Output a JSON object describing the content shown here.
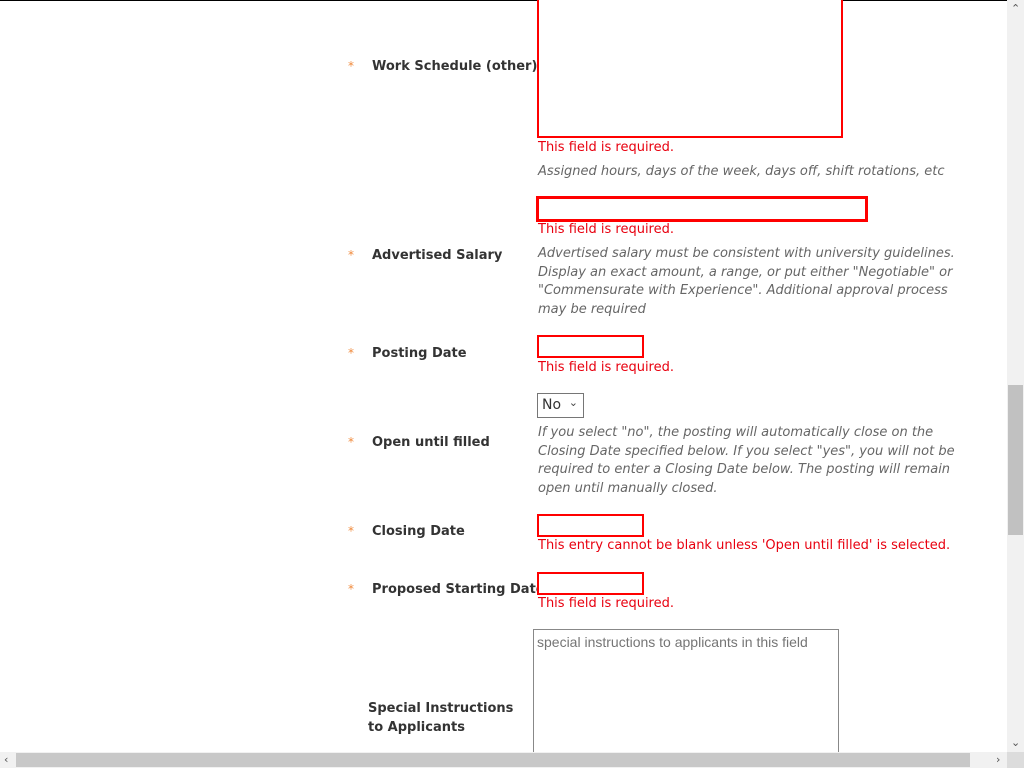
{
  "required_marker": "*",
  "fields": {
    "work_schedule": {
      "label": "Work Schedule (other)",
      "error": "This field is required.",
      "hint": "Assigned hours, days of the week, days off, shift rotations, etc"
    },
    "advertised_salary": {
      "label": "Advertised Salary",
      "error": "This field is required.",
      "hint": "Advertised salary must be consistent with university guidelines. Display an exact amount, a range, or put either \"Negotiable\" or \"Commensurate with Experience\". Additional approval process may be required"
    },
    "posting_date": {
      "label": "Posting Date",
      "error": "This field is required."
    },
    "open_until_filled": {
      "label": "Open until filled",
      "selected": "No",
      "hint": "If you select \"no\", the posting will automatically close on the Closing Date specified below. If you select \"yes\", you will not be required to enter a Closing Date below. The posting will remain open until manually closed."
    },
    "closing_date": {
      "label": "Closing Date",
      "error": "This entry cannot be blank unless 'Open until filled' is selected."
    },
    "proposed_starting_date": {
      "label": "Proposed Starting Date",
      "error": "This field is required."
    },
    "special_instructions": {
      "label": "Special Instructions to Applicants",
      "placeholder": "special instructions to applicants in this field"
    }
  },
  "colors": {
    "error": "#e8000f",
    "required": "#f08a3c"
  }
}
